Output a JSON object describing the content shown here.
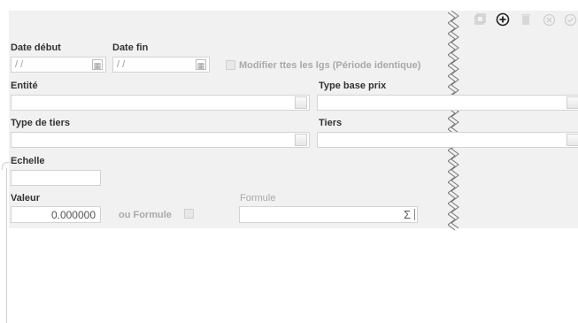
{
  "toolbar": {
    "copy_icon": "copy-icon",
    "add_icon": "add-circle-icon",
    "delete_icon": "trash-icon",
    "cancel_icon": "cancel-circle-icon",
    "validate_icon": "check-circle-icon"
  },
  "form": {
    "date_debut": {
      "label": "Date début",
      "value": "/ /"
    },
    "date_fin": {
      "label": "Date fin",
      "value": "/ /"
    },
    "modifier": {
      "label": "Modifier ttes les lgs (Période identique)"
    },
    "entite": {
      "label": "Entité",
      "value": ""
    },
    "type_base_prix": {
      "label": "Type base prix",
      "value": ""
    },
    "type_tiers": {
      "label": "Type de tiers",
      "value": ""
    },
    "tiers": {
      "label": "Tiers",
      "value": ""
    },
    "echelle": {
      "label": "Echelle",
      "value": ""
    },
    "valeur": {
      "label": "Valeur",
      "value": "0.000000"
    },
    "ou_formule": {
      "label": "ou Formule"
    },
    "formule": {
      "label": "Formule",
      "value": "",
      "sigma": "Σ"
    }
  },
  "colors": {
    "panel_bg": "#f1f1f1",
    "field_border": "#d3d3d3",
    "label": "#333333",
    "label_disabled": "#a9a9a9",
    "icon": "#c8c8c8",
    "icon_active": "#333333"
  }
}
